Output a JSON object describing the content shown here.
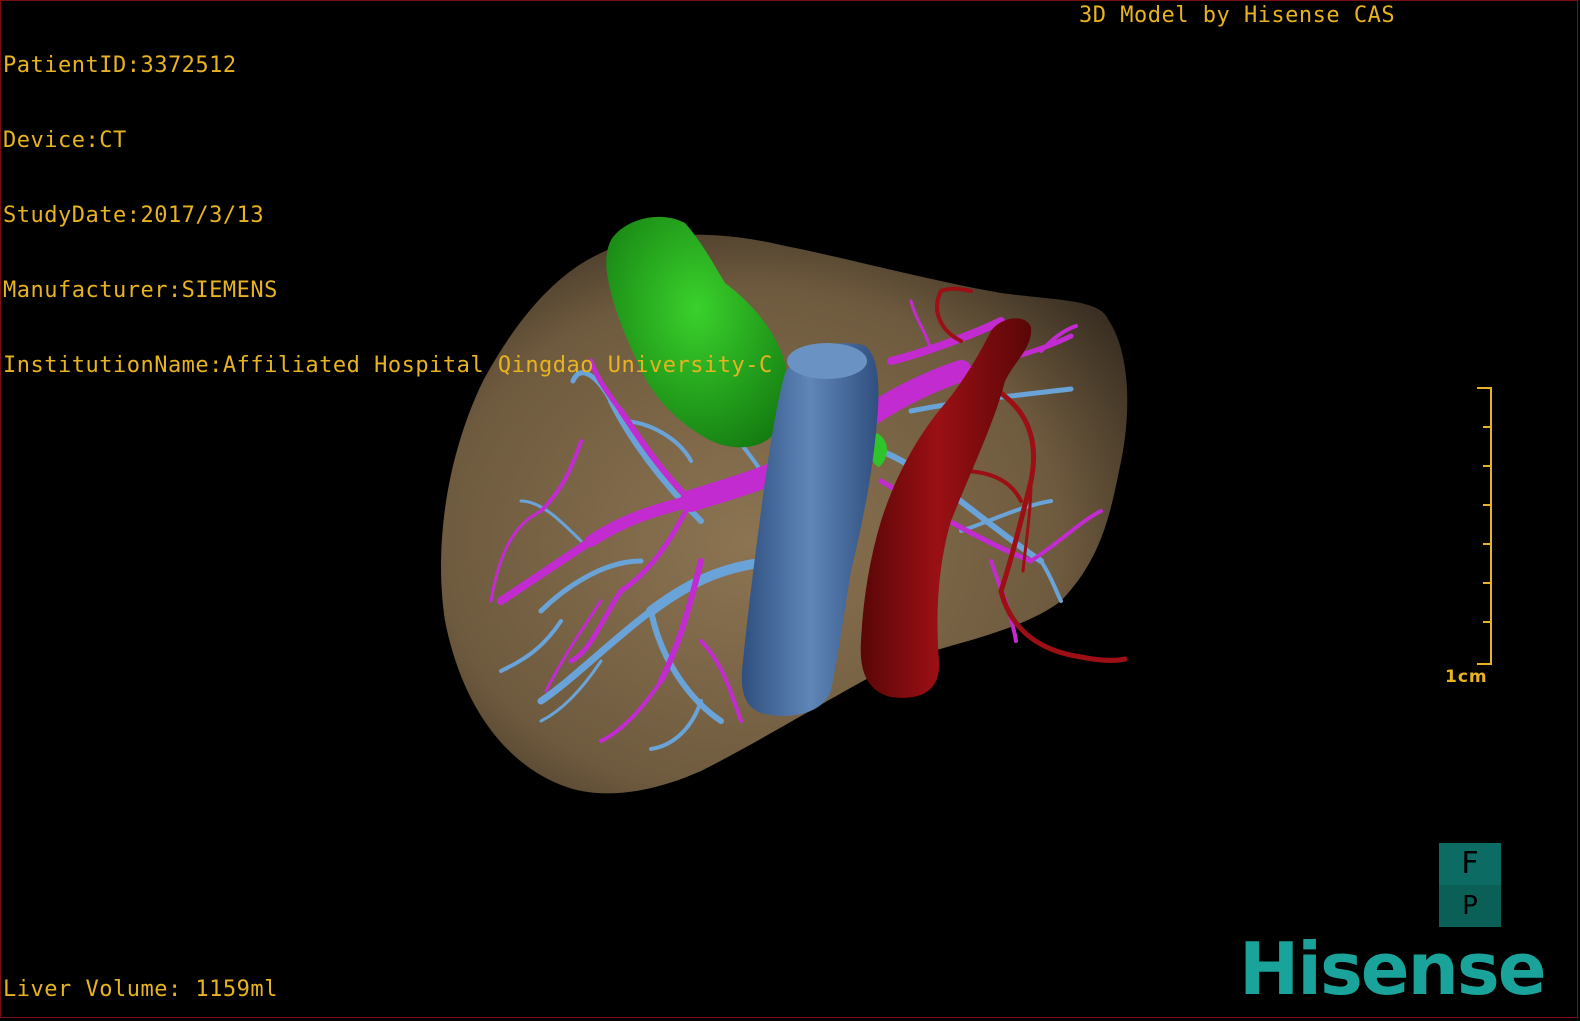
{
  "overlay": {
    "patient_id": "PatientID:3372512",
    "device": "Device:CT",
    "study_date": "StudyDate:2017/3/13",
    "manufacturer": "Manufacturer:SIEMENS",
    "institution": "InstitutionName:Affiliated Hospital Qingdao University-C",
    "credit": "3D Model by Hisense CAS",
    "liver_volume": "Liver Volume: 1159ml"
  },
  "scale": {
    "label": "1cm"
  },
  "orientation": {
    "top": "F",
    "bottom": "P"
  },
  "brand": {
    "name": "Hisense"
  },
  "colors": {
    "text": "#e8b320",
    "liver": "#7a6446",
    "gallbladder": "#1f9e1a",
    "inferior_vena_cava": "#4f74a5",
    "portal_vein": "#c22bd0",
    "hepatic_vein": "#6aa3d8",
    "aorta": "#8a0c0f",
    "brand": "#1aa39a",
    "border": "#7a0f12"
  }
}
